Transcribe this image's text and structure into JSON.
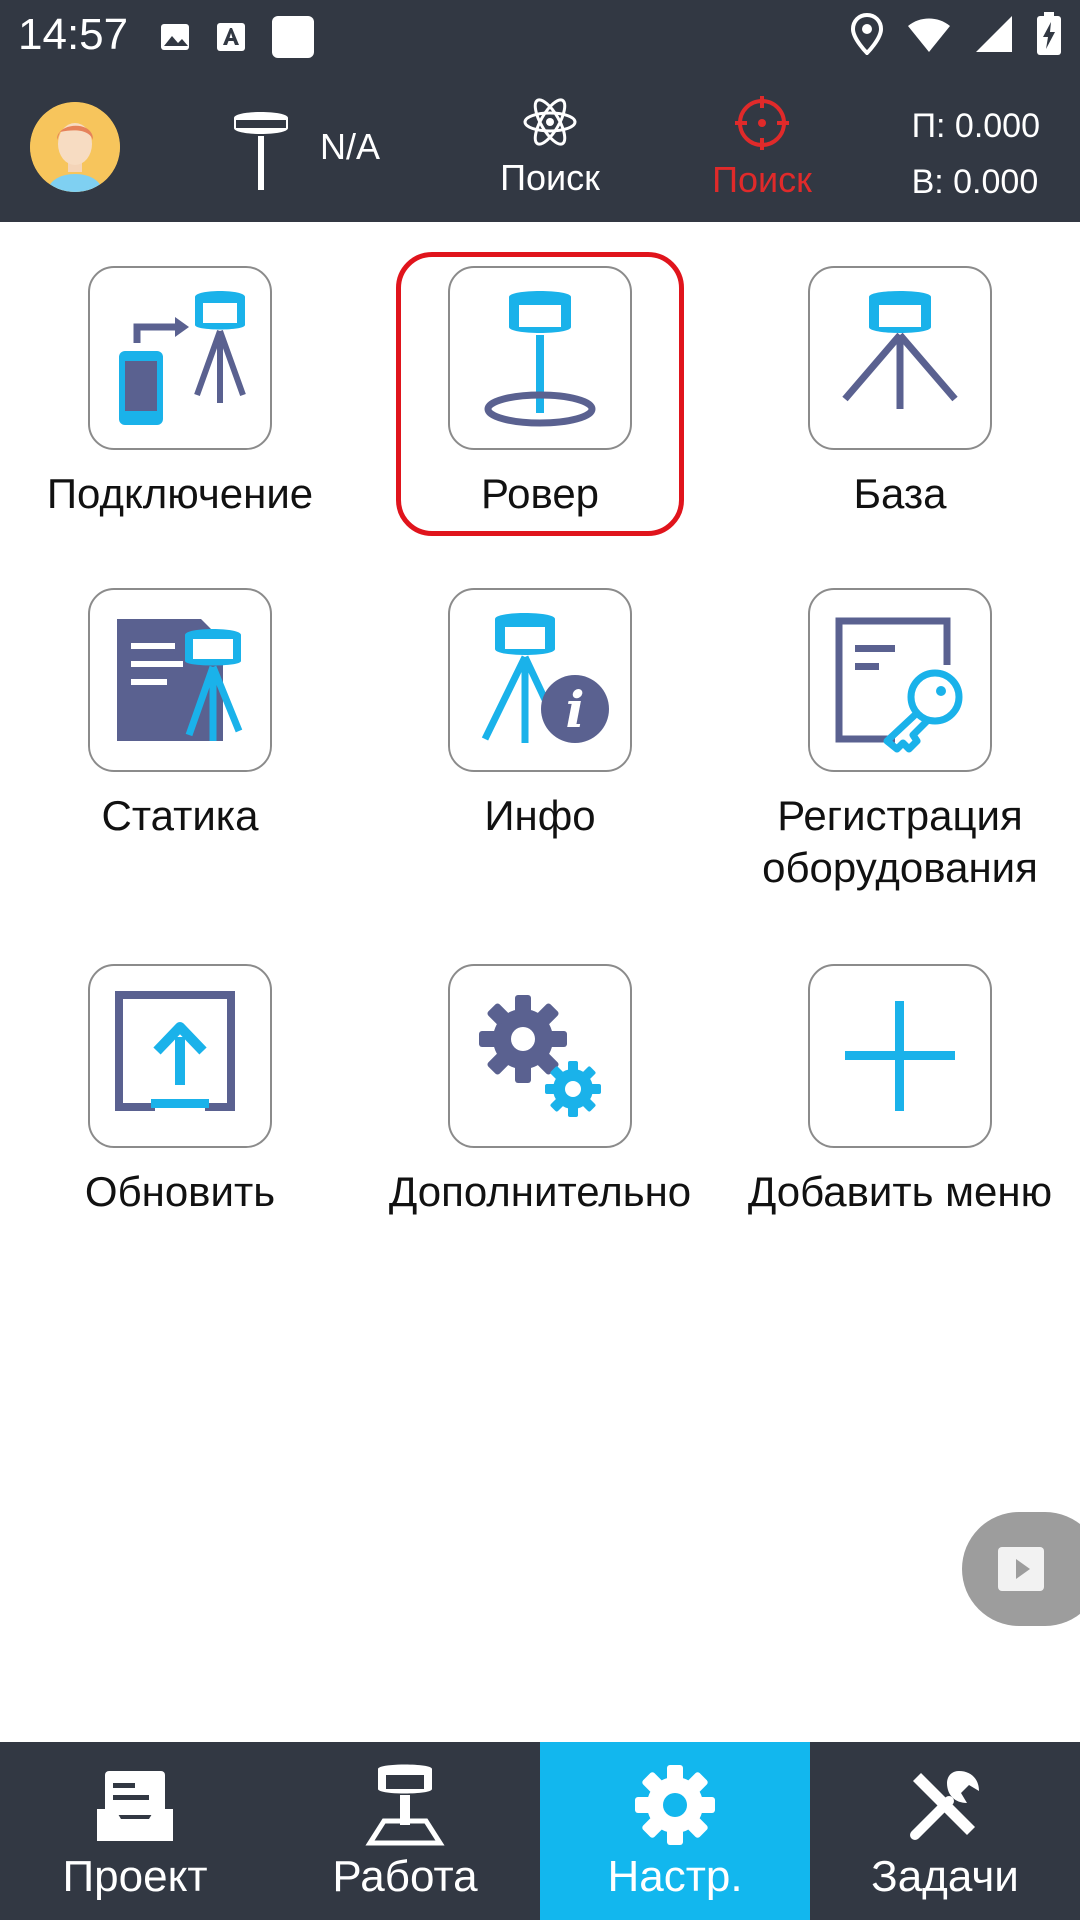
{
  "status_bar": {
    "time": "14:57"
  },
  "header": {
    "device_status": "N/A",
    "search_label_1": "Поиск",
    "search_label_2": "Поиск",
    "coord_p": "П: 0.000",
    "coord_v": "В: 0.000"
  },
  "tiles": [
    {
      "label": "Подключение"
    },
    {
      "label": "Ровер"
    },
    {
      "label": "База"
    },
    {
      "label": "Статика"
    },
    {
      "label": "Инфо"
    },
    {
      "label": "Регистрация оборудования"
    },
    {
      "label": "Обновить"
    },
    {
      "label": "Дополнительно"
    },
    {
      "label": "Добавить меню"
    }
  ],
  "bottom_nav": [
    {
      "label": "Проект",
      "active": false
    },
    {
      "label": "Работа",
      "active": false
    },
    {
      "label": "Настр.",
      "active": true
    },
    {
      "label": "Задачи",
      "active": false
    }
  ],
  "colors": {
    "dark": "#323843",
    "accent": "#12b7ee",
    "selection": "#e0141c",
    "icon_blue": "#1ab2ea",
    "icon_dark": "#5a6190"
  }
}
